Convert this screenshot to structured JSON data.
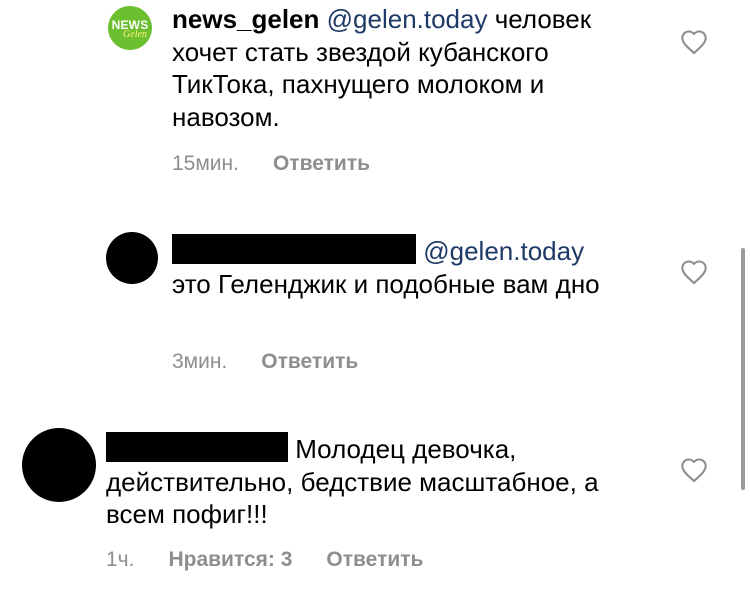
{
  "comments": [
    {
      "username": "news_gelen",
      "avatar_logo_top": "NEWS",
      "avatar_logo_bottom": "Gelen",
      "mention": "@gelen.today",
      "text": " человек хочет стать звездой кубанского ТикТока, пахнущего молоком и навозом.",
      "time": "15мин.",
      "reply_label": "Ответить",
      "like_icon": "heart-outline-icon"
    },
    {
      "username_redacted": true,
      "mention": "@gelen.today",
      "text": "это Геленджик и подобные вам дно",
      "time": "3мин.",
      "reply_label": "Ответить",
      "like_icon": "heart-outline-icon"
    },
    {
      "username_redacted": true,
      "text": " Молодец девочка, действительно, бедствие масштабное, а всем пофиг!!!",
      "time": "1ч.",
      "likes_label": "Нравится: 3",
      "reply_label": "Ответить",
      "like_icon": "heart-outline-icon"
    }
  ],
  "colors": {
    "background": "#ffffff",
    "text": "#000000",
    "mention": "#1e3a66",
    "meta": "#8e8e8e",
    "logo_green": "#6cbf2f"
  }
}
